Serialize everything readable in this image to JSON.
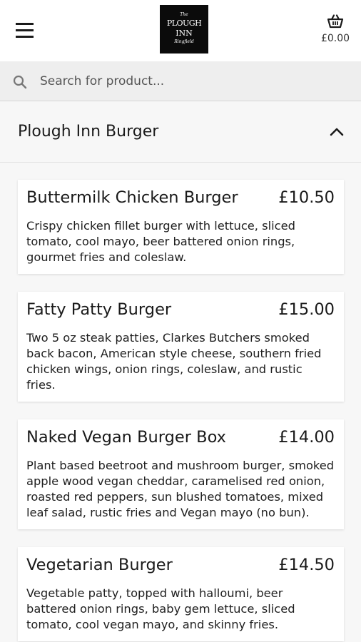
{
  "header": {
    "logo": {
      "line1": "The",
      "line2": "PLOUGH",
      "line3": "INN",
      "line4": "Ringfield"
    },
    "basket_total": "£0.00"
  },
  "search": {
    "placeholder": "Search for product..."
  },
  "category": {
    "title": "Plough Inn Burger"
  },
  "products": [
    {
      "name": "Buttermilk Chicken Burger",
      "price": "£10.50",
      "description": "Crispy chicken fillet burger with lettuce, sliced tomato, cool mayo, beer battered onion rings, gourmet fries and coleslaw."
    },
    {
      "name": "Fatty Patty Burger",
      "price": "£15.00",
      "description": "Two 5 oz steak patties, Clarkes Butchers smoked back bacon, American style cheese, southern fried chicken wings, onion rings, coleslaw, and rustic fries."
    },
    {
      "name": "Naked Vegan Burger Box",
      "price": "£14.00",
      "description": "Plant based beetroot and mushroom burger, smoked apple wood vegan cheddar, caramelised red onion, roasted red peppers, sun blushed tomatoes, mixed leaf salad, rustic fries and Vegan mayo (no bun)."
    },
    {
      "name": "Vegetarian Burger",
      "price": "£14.50",
      "description": "Vegetable patty, topped with halloumi, beer battered onion rings, baby gem lettuce, sliced tomato, cool vegan mayo, and skinny fries."
    }
  ]
}
